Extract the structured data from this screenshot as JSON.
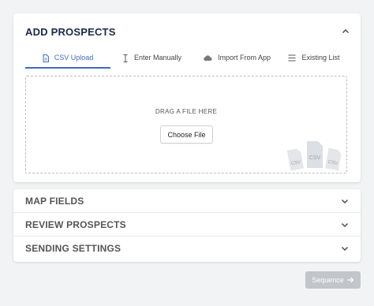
{
  "add_prospects": {
    "title": "ADD PROSPECTS",
    "tabs": [
      {
        "label": "CSV Upload",
        "icon": "file-icon",
        "active": true
      },
      {
        "label": "Enter Manually",
        "icon": "text-cursor-icon",
        "active": false
      },
      {
        "label": "Import From App",
        "icon": "cloud-icon",
        "active": false
      },
      {
        "label": "Existing List",
        "icon": "list-icon",
        "active": false
      }
    ],
    "dropzone": {
      "text": "DRAG A FILE HERE",
      "button_label": "Choose File",
      "file_labels": [
        "CSV",
        "CSV",
        "CSV"
      ]
    }
  },
  "sections": [
    {
      "label": "MAP FIELDS"
    },
    {
      "label": "REVIEW PROSPECTS"
    },
    {
      "label": "SENDING SETTINGS"
    }
  ],
  "footer": {
    "sequence_label": "Sequence"
  },
  "colors": {
    "accent": "#3e6ebc",
    "title": "#1b2a48",
    "disabled_button": "#c2c5c9",
    "background": "#f2f3f5"
  }
}
